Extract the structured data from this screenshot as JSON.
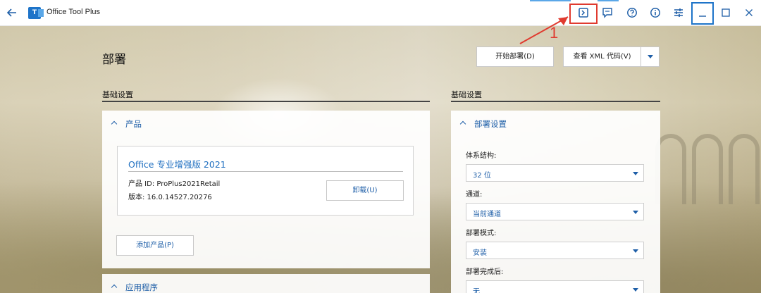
{
  "app": {
    "title": "Office Tool Plus",
    "logo_text": "T"
  },
  "annotation": {
    "number": "1",
    "color": "#e03a2f"
  },
  "colors": {
    "accent": "#1f5fa8",
    "highlight_red": "#e03a2f",
    "highlight_blue": "#1e74c9"
  },
  "titlebar": {
    "icons": [
      "back-arrow-icon",
      "terminal-icon",
      "feedback-icon",
      "help-icon",
      "info-icon",
      "settings-sliders-icon",
      "minimize-icon",
      "maximize-icon",
      "close-icon"
    ]
  },
  "header": {
    "title": "部署",
    "start_button": "开始部署(D)",
    "xml_button": "查看 XML 代码(V)"
  },
  "left": {
    "section_title": "基础设置",
    "products_panel": {
      "title": "产品",
      "card": {
        "name": "Office 专业增强版 2021",
        "id_line": "产品 ID: ProPlus2021Retail",
        "version_line": "版本: 16.0.14527.20276",
        "uninstall_button": "卸载(U)"
      },
      "add_button": "添加产品(P)"
    },
    "apps_panel": {
      "title": "应用程序"
    }
  },
  "right": {
    "section_title": "基础设置",
    "deploy_panel": {
      "title": "部署设置",
      "fields": [
        {
          "label": "体系结构:",
          "value": "32 位"
        },
        {
          "label": "通道:",
          "value": "当前通道"
        },
        {
          "label": "部署模式:",
          "value": "安装"
        },
        {
          "label": "部署完成后:",
          "value": "无"
        }
      ]
    }
  }
}
